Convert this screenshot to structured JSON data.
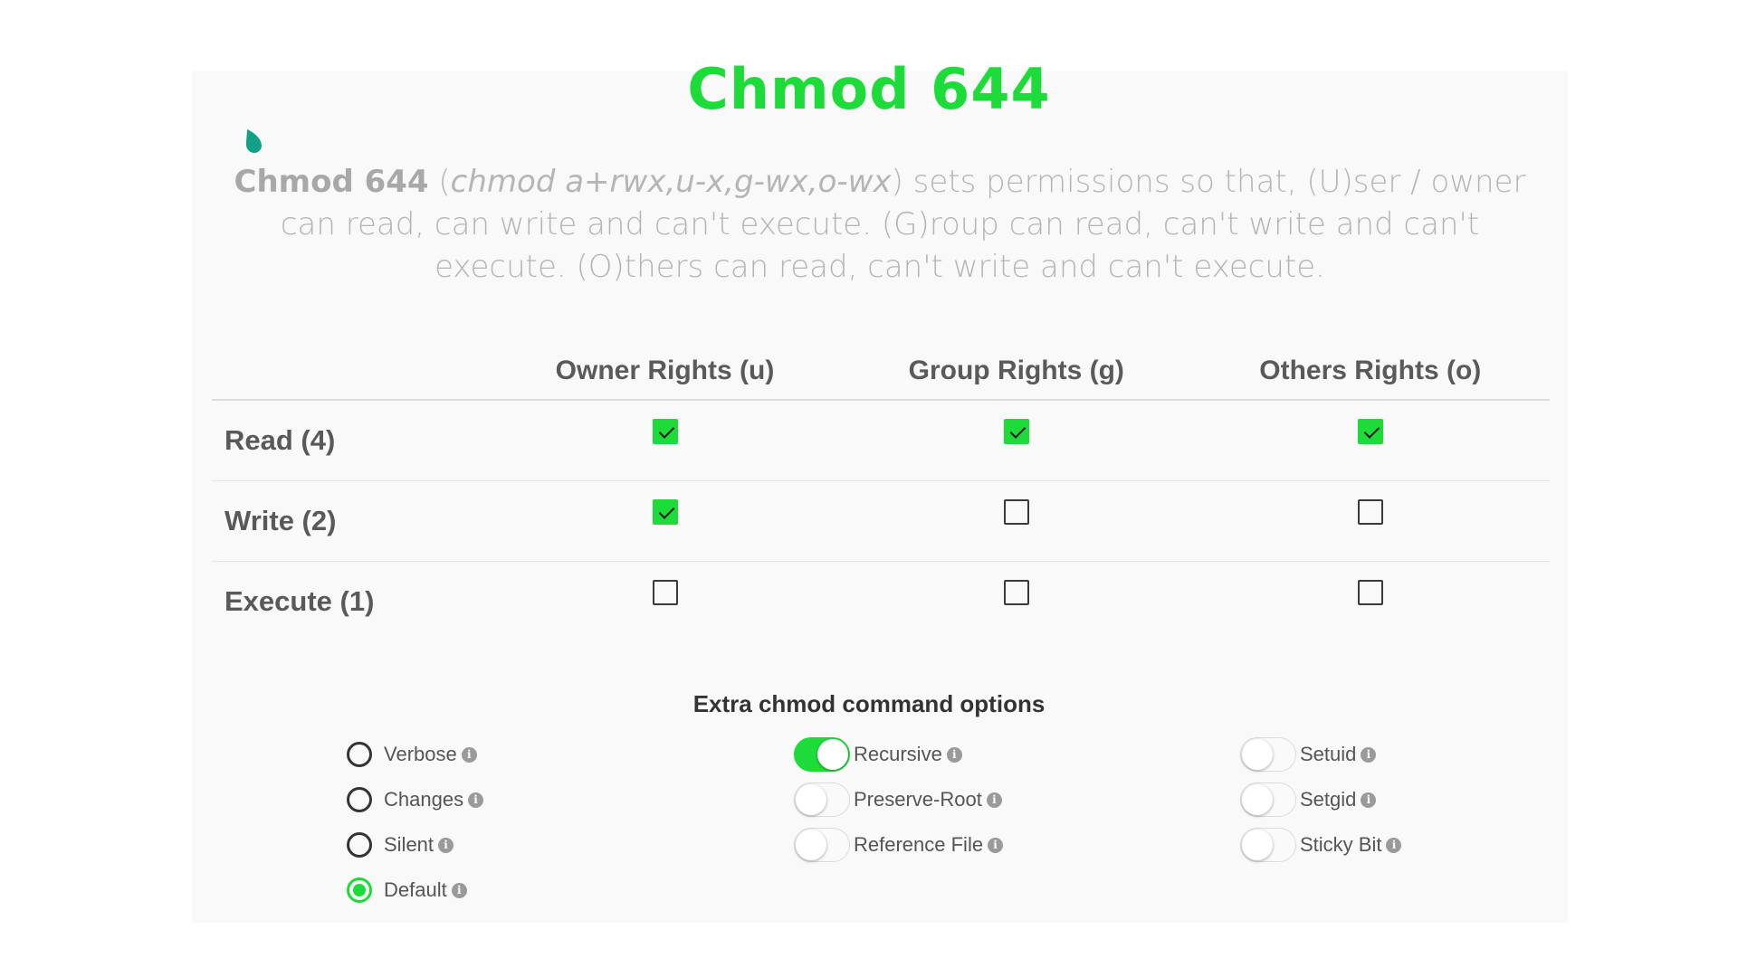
{
  "title": "Chmod 644",
  "description": {
    "bold": "Chmod 644",
    "paren_open": " (",
    "italic": "chmod a+rwx,u-x,g-wx,o-wx",
    "rest": ") sets permissions so that, (U)ser / owner can read, can write and can't execute. (G)roup can read, can't write and can't execute. (O)thers can read, can't write and can't execute."
  },
  "table": {
    "headers": [
      "Owner Rights (u)",
      "Group Rights (g)",
      "Others Rights (o)"
    ],
    "rows": [
      {
        "label": "Read (4)",
        "checked": [
          true,
          true,
          true
        ]
      },
      {
        "label": "Write (2)",
        "checked": [
          true,
          false,
          false
        ]
      },
      {
        "label": "Execute (1)",
        "checked": [
          false,
          false,
          false
        ]
      }
    ]
  },
  "options": {
    "title": "Extra chmod command options",
    "radios": [
      {
        "label": "Verbose",
        "selected": false
      },
      {
        "label": "Changes",
        "selected": false
      },
      {
        "label": "Silent",
        "selected": false
      },
      {
        "label": "Default",
        "selected": true
      }
    ],
    "toggles_col2": [
      {
        "label": "Recursive",
        "on": true
      },
      {
        "label": "Preserve-Root",
        "on": false
      },
      {
        "label": "Reference File",
        "on": false
      }
    ],
    "toggles_col3": [
      {
        "label": "Setuid",
        "on": false
      },
      {
        "label": "Setgid",
        "on": false
      },
      {
        "label": "Sticky Bit",
        "on": false
      }
    ]
  },
  "colors": {
    "accent": "#1ddc3a",
    "drop_icon": "#12a089"
  },
  "icons": {
    "info": "info-circle-icon",
    "drop": "water-drop-icon"
  }
}
